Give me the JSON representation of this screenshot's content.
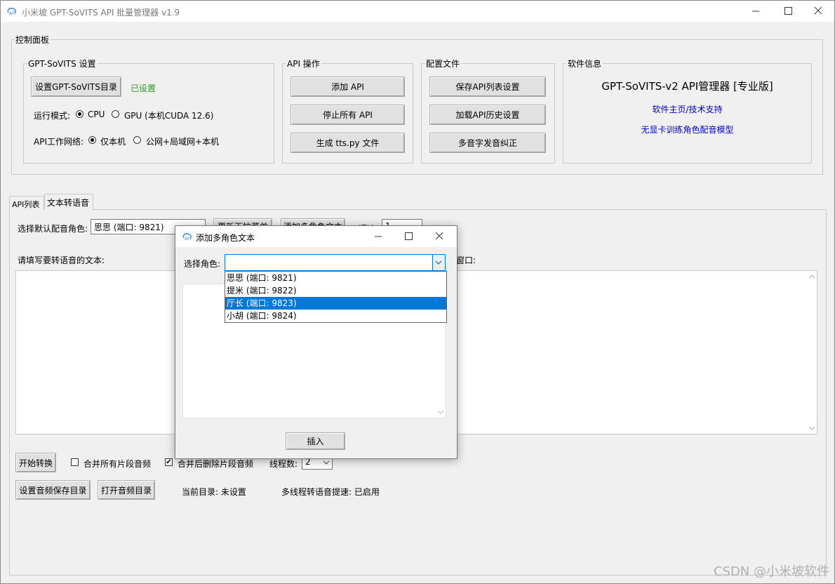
{
  "window": {
    "title": "小米坡 GPT-SoVITS API 批量管理器 v1.9",
    "icon": "app-logo-icon",
    "controls": [
      "minimize-icon",
      "maximize-icon",
      "close-icon"
    ]
  },
  "control_panel": {
    "title": "控制面板",
    "gptsovits": {
      "title": "GPT-SoVITS 设置",
      "set_dir_label": "设置GPT-SoVITS目录",
      "status": "已设置",
      "mode_label": "运行模式:",
      "mode_options": [
        "CPU",
        "GPU (本机CUDA 12.6)"
      ],
      "mode_selected": "CPU",
      "network_label": "API工作网络:",
      "network_options": [
        "仅本机",
        "公网+局域网+本机"
      ],
      "network_selected": "仅本机"
    },
    "api_ops": {
      "title": "API 操作",
      "buttons": [
        "添加 API",
        "停止所有 API",
        "生成 tts.py 文件"
      ]
    },
    "config": {
      "title": "配置文件",
      "buttons": [
        "保存API列表设置",
        "加载API历史设置",
        "多音字发音纠正"
      ]
    },
    "info": {
      "title": "软件信息",
      "product": "GPT-SoVITS-v2 API管理器 [专业版]",
      "links": [
        "软件主页/技术支持",
        "无显卡训练角色配音模型"
      ]
    }
  },
  "tabs": [
    "API列表",
    "文本转语音"
  ],
  "active_tab": "文本转语音",
  "tts": {
    "default_voice_label": "选择默认配音角色:",
    "default_voice_value": "思思 (端口: 9821)",
    "refresh_label": "更新下拉菜单",
    "add_multi_label": "添加多角色文本",
    "speed_label": "语速:",
    "speed_value": "1",
    "text_label": "请填写要转语音的文本:",
    "right_label_suffix": "窗口:",
    "start_label": "开始转换",
    "merge_label": "合并所有片段音频",
    "merge_checked": false,
    "delete_label": "合并后删除片段音频",
    "delete_checked": true,
    "threads_label": "线程数:",
    "threads_value": "2",
    "set_dir_label": "设置音频保存目录",
    "open_dir_label": "打开音频目录",
    "current_dir": "当前目录: 未设置",
    "multithread_status": "多线程转语音提速: 已启用"
  },
  "dialog": {
    "title": "添加多角色文本",
    "icon": "app-logo-icon",
    "controls": [
      "minimize-icon",
      "maximize-icon",
      "close-icon"
    ],
    "role_label": "选择角色:",
    "role_value": "",
    "options": [
      "思思 (端口: 9821)",
      "提米 (端口: 9822)",
      "厅长 (端口: 9823)",
      "小胡 (端口: 9824)"
    ],
    "highlighted_index": 2,
    "insert_label": "插入"
  },
  "watermark": "CSDN @小米坡软件"
}
